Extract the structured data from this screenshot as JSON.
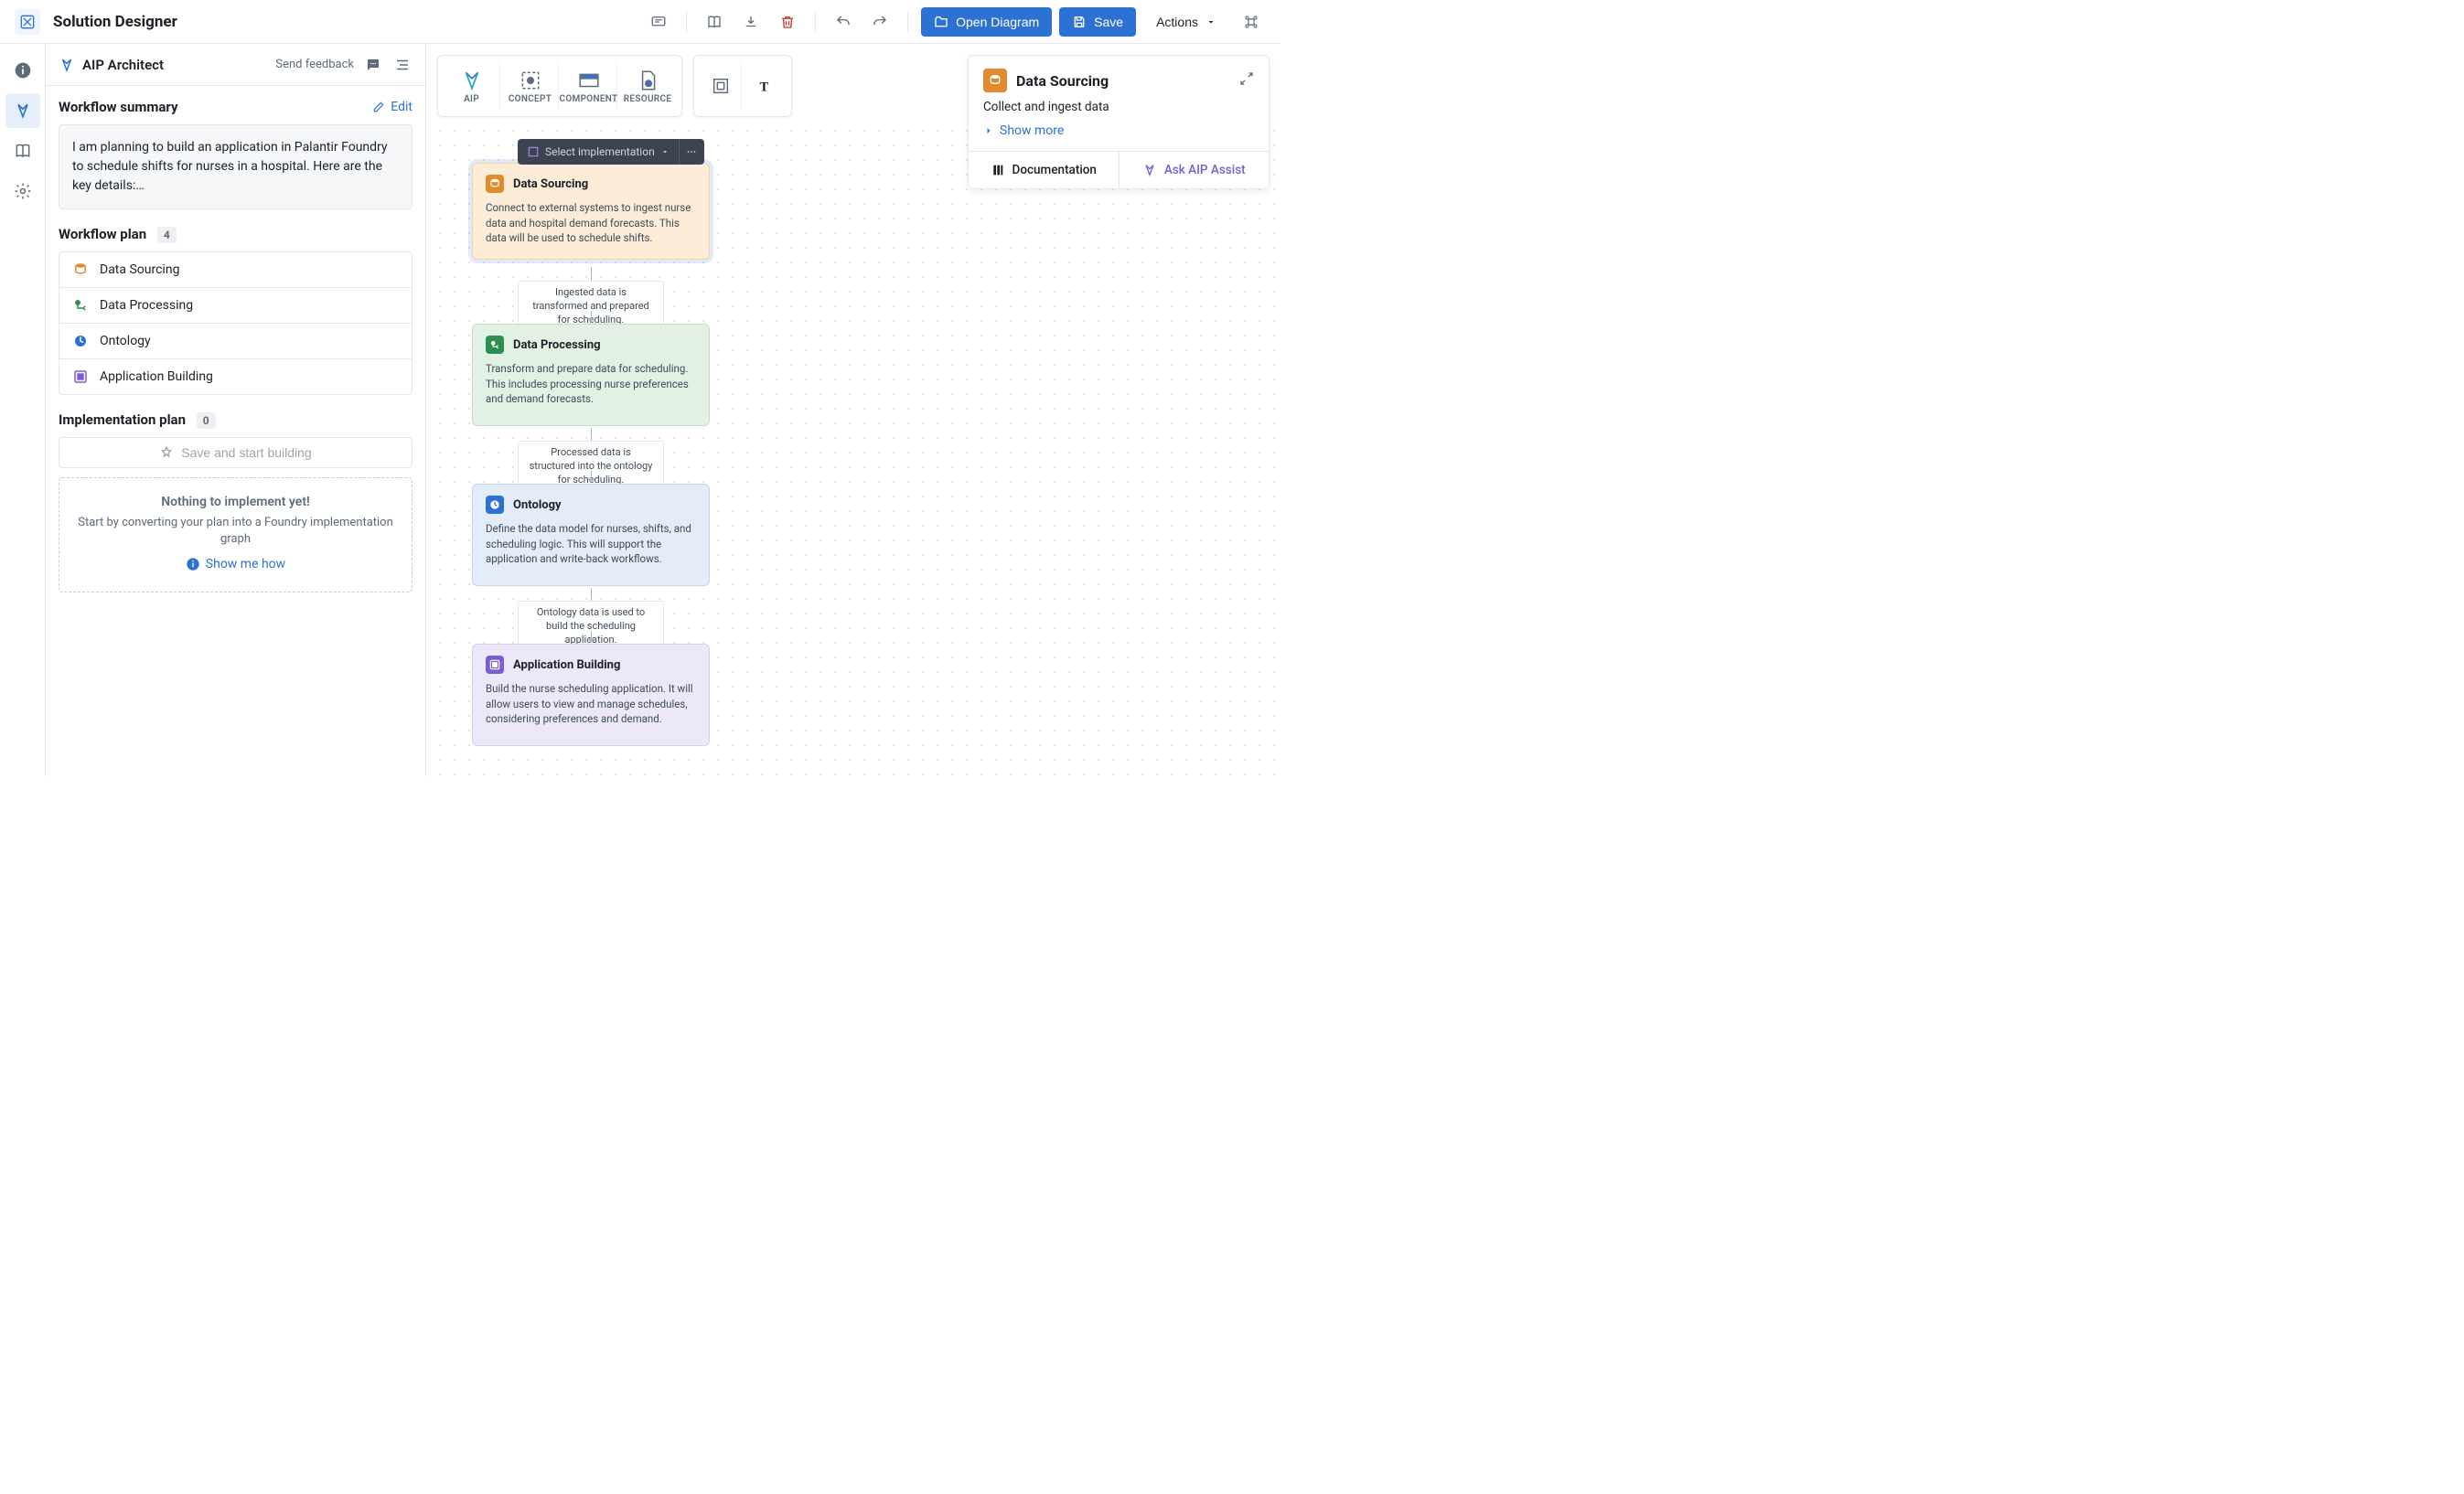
{
  "header": {
    "title": "Solution Designer",
    "open_diagram": "Open Diagram",
    "save": "Save",
    "actions": "Actions"
  },
  "sidebar": {
    "panel_title": "AIP Architect",
    "send_feedback": "Send feedback",
    "summary_heading": "Workflow summary",
    "edit": "Edit",
    "summary_text": "I am planning to build an application in Palantir Foundry to schedule shifts for nurses in a hospital. Here are the key details:…",
    "plan_heading": "Workflow plan",
    "plan_count": "4",
    "plan_items": [
      {
        "label": "Data Sourcing"
      },
      {
        "label": "Data Processing"
      },
      {
        "label": "Ontology"
      },
      {
        "label": "Application Building"
      }
    ],
    "impl_heading": "Implementation plan",
    "impl_count": "0",
    "save_build": "Save and start building",
    "empty_title": "Nothing to implement yet!",
    "empty_body": "Start by converting your plan into a Foundry implementation graph",
    "show_how": "Show me how"
  },
  "toolbox": {
    "aip": "AIP",
    "concept": "CONCEPT",
    "component": "COMPONENT",
    "resource": "RESOURCE"
  },
  "impl_pill": "Select implementation",
  "nodes": [
    {
      "id": "data-sourcing",
      "title": "Data Sourcing",
      "body": "Connect to external systems to ingest nurse data and hospital demand forecasts. This data will be used to schedule shifts."
    },
    {
      "id": "data-processing",
      "title": "Data Processing",
      "body": "Transform and prepare data for scheduling. This includes processing nurse preferences and demand forecasts."
    },
    {
      "id": "ontology",
      "title": "Ontology",
      "body": "Define the data model for nurses, shifts, and scheduling logic. This will support the application and write-back workflows."
    },
    {
      "id": "app-building",
      "title": "Application Building",
      "body": "Build the nurse scheduling application. It will allow users to view and manage schedules, considering preferences and demand."
    }
  ],
  "edges": [
    {
      "label": "Ingested data is transformed and prepared for scheduling."
    },
    {
      "label": "Processed data is structured into the ontology for scheduling."
    },
    {
      "label": "Ontology data is used to build the scheduling application."
    }
  ],
  "right_panel": {
    "title": "Data Sourcing",
    "subtitle": "Collect and ingest data",
    "show_more": "Show more",
    "documentation": "Documentation",
    "ask_assist": "Ask AIP Assist"
  }
}
